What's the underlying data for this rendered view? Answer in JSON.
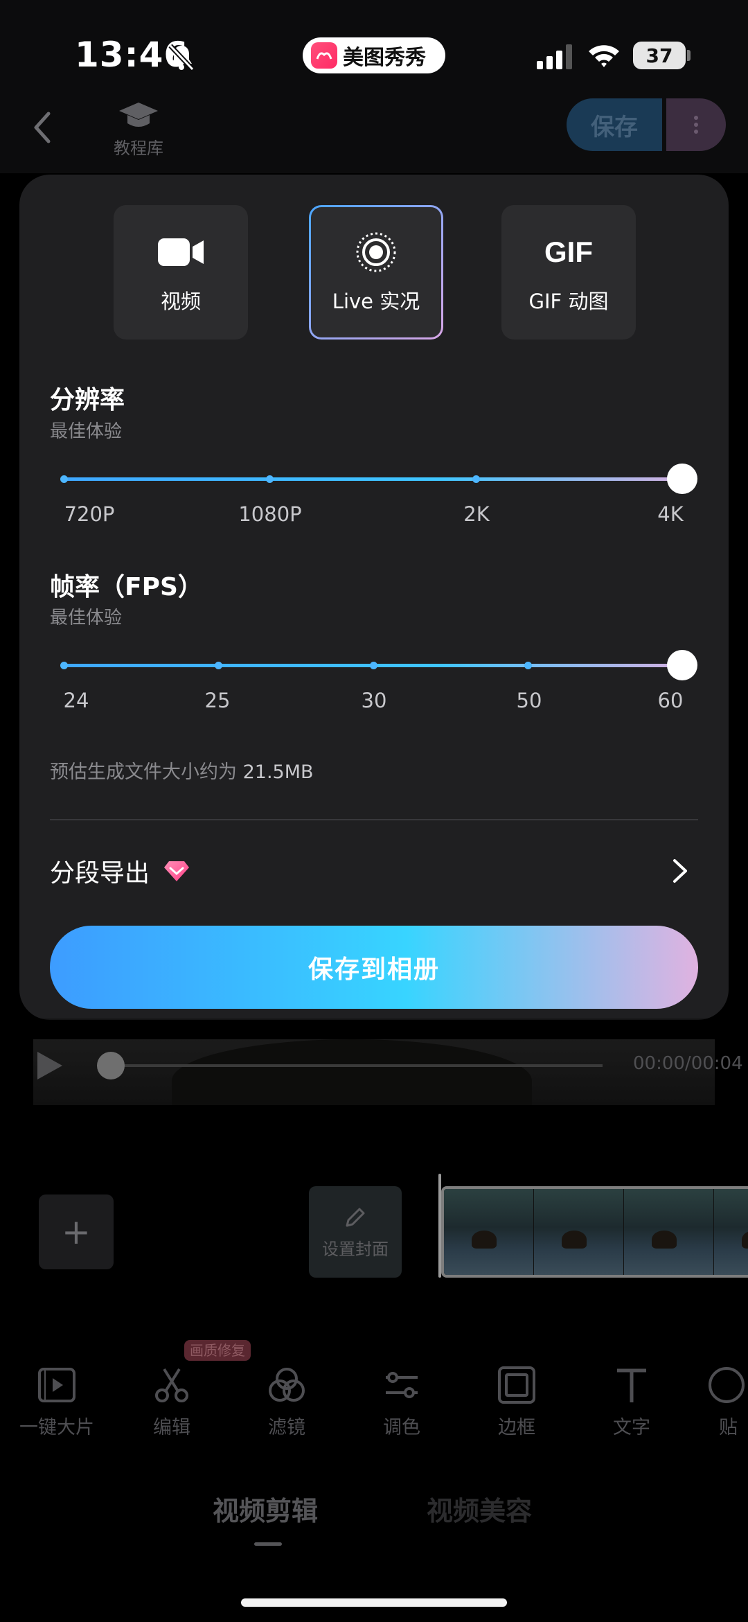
{
  "status_bar": {
    "time": "13:46",
    "app_name": "美图秀秀",
    "battery": "37",
    "icons": [
      "bell-slash-icon",
      "signal-icon",
      "wifi-icon",
      "battery-icon"
    ]
  },
  "header": {
    "tutorial_label": "教程库",
    "save_label": "保存"
  },
  "export_sheet": {
    "formats": [
      {
        "label": "视频",
        "icon": "video-camera-icon",
        "selected": false
      },
      {
        "label": "Live 实况",
        "icon": "live-photo-icon",
        "selected": true
      },
      {
        "label": "GIF 动图",
        "icon_text": "GIF",
        "selected": false
      }
    ],
    "resolution": {
      "title": "分辨率",
      "subtitle": "最佳体验",
      "options": [
        "720P",
        "1080P",
        "2K",
        "4K"
      ],
      "selected_value": "4K"
    },
    "fps": {
      "title": "帧率（FPS）",
      "subtitle": "最佳体验",
      "options": [
        "24",
        "25",
        "30",
        "50",
        "60"
      ],
      "selected_value": "60"
    },
    "size_estimate_prefix": "预估生成文件大小约为",
    "size_estimate_value": "21.5MB",
    "segment_export_label": "分段导出",
    "save_button_label": "保存到相册"
  },
  "player": {
    "timecode": "00:00/00:04"
  },
  "timeline": {
    "cover_label": "设置封面"
  },
  "toolbar": {
    "badge": "画质修复",
    "items": [
      {
        "label": "一键大片",
        "icon": "magic-film-icon"
      },
      {
        "label": "编辑",
        "icon": "scissors-icon"
      },
      {
        "label": "滤镜",
        "icon": "filter-icon"
      },
      {
        "label": "调色",
        "icon": "adjust-sliders-icon"
      },
      {
        "label": "边框",
        "icon": "frame-icon"
      },
      {
        "label": "文字",
        "icon": "text-icon"
      },
      {
        "label": "贴",
        "icon": "sticker-icon"
      }
    ]
  },
  "bottom_tabs": {
    "edit": "视频剪辑",
    "beauty": "视频美容"
  },
  "colors": {
    "accent_start": "#3d9cff",
    "accent_mid": "#38d4ff",
    "accent_end": "#e0b2e0",
    "sheet_bg": "#1f1f21"
  }
}
